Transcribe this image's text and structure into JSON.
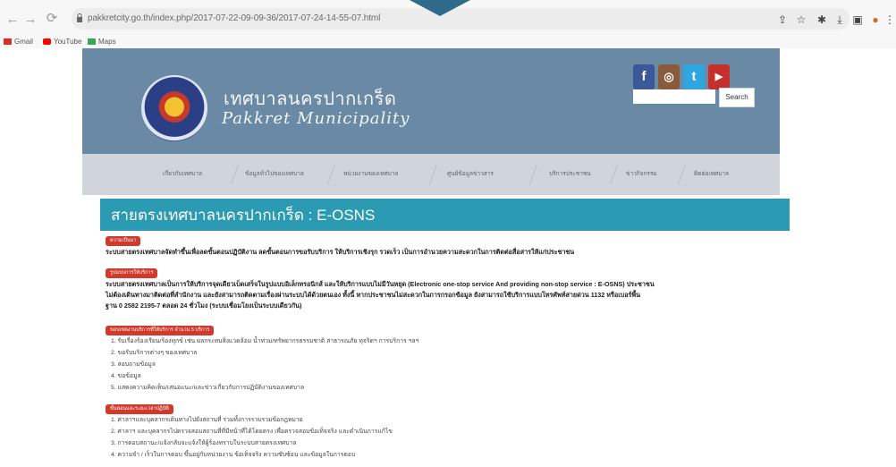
{
  "browser": {
    "url": "pakkretcity.go.th/index.php/2017-07-22-09-09-36/2017-07-24-14-55-07.html",
    "bookmarks": [
      "Gmail",
      "YouTube",
      "Maps"
    ],
    "accent": "#2f6a8a"
  },
  "site": {
    "name_th": "เทศบาลนครปากเกร็ด",
    "name_en": "Pakkret Municipality",
    "search_button": "Search",
    "search_placeholder": "",
    "social": [
      {
        "icon": "facebook-icon",
        "glyph": "f",
        "color": "#3b5998"
      },
      {
        "icon": "instagram-icon",
        "glyph": "◎",
        "color": "#8a5a3c"
      },
      {
        "icon": "twitter-icon",
        "glyph": "t",
        "color": "#2fa6e0"
      },
      {
        "icon": "youtube-icon",
        "glyph": "▶",
        "color": "#c4302b"
      }
    ],
    "header_color": "#6a89a4"
  },
  "menu": [
    "เกี่ยวกับเทศบาล",
    "ข้อมูลทั่วไปของเทศบาล",
    "หน่วยงานของเทศบาล",
    "ศูนย์ข้อมูลข่าวสาร",
    "บริการประชาชน",
    "ข่าวกิจกรรม",
    "ติดต่อเทศบาล"
  ],
  "page": {
    "title": "สายตรงเทศบาลนครปากเกร็ด : E-OSNS",
    "banner_color": "#2b9ab3",
    "sections": [
      {
        "tag": "ความเป็นมา",
        "paragraphs": [
          "ระบบสายตรงเทศบาลจัดทำขึ้นเพื่อลดขั้นตอนปฏิบัติงาน ลดขั้นตอนการขอรับบริการ ให้บริการเชิงรุก รวดเร็ว เป็นการอำนวยความสะดวกในการติดต่อสื่อสารให้แก่ประชาชน"
        ]
      },
      {
        "tag": "รูปแบบการให้บริการ",
        "paragraphs": [
          "ระบบสายตรงเทศบาลเป็นการให้บริการจุดเดียวเบ็ดเสร็จในรูปแบบอิเล็กทรอนิกส์ และให้บริการแบบไม่มีวันหยุด (Electronic one-stop service And providing non-stop service : E-OSNS) ประชาชน",
          "ไม่ต้องเดินทางมาติดต่อที่สำนักงาน และยังสามารถติดตามเรื่องผ่านระบบได้ด้วยตนเอง ทั้งนี้ หากประชาชนไม่สะดวกในการกรอกข้อมูล ยังสามารถใช้บริการแบบโทรศัพท์สายด่วน 1132 หรือเบอร์พื้น",
          "ฐาน 0 2582 2195-7 ตลอด 24 ชั่วโมง (ระบบเชื่อมโยงเป็นระบบเดียวกัน)"
        ]
      },
      {
        "tag": "ขอบเขตงานบริการที่ให้บริการ จำนวน 5 บริการ",
        "items": [
          "1. รับเรื่องร้องเรียน/ร้องทุกข์ เช่น ผลกระทบสิ่งแวดล้อม น้ำท่วม/ทรัพยากรธรรมชาติ สาธารณภัย ทุจริตฯ การบริการ ฯลฯ",
          "2. ขอรับบริการต่างๆ ของเทศบาล",
          "3. สอบถามข้อมูล",
          "4. ขอข้อมูล",
          "5. แสดงความคิดเห็น/เสนอแนะ/และข่าวเกี่ยวกับการปฏิบัติงานของเทศบาล"
        ]
      },
      {
        "tag": "ขั้นตอนและระยะเวลาปฏิบัติ",
        "items": [
          "1. ศาลาฯและบุคลากรเดินทางไปยังสถานที่ ร่วมทั้งการรวบรวมข้อกฎหมาย",
          "2. ศาลาฯ และบุคลากรไปตรวจสอบสถานที่ที่มีหน้าที่ได้โดยตรง เพื่อตรวจสอบข้อเท็จจริง และดำเนินการแก้ไข",
          "3. การตอบสถานะ/แจ้งกลับจะแจ้งให้ผู้ร้องทราบในระบบสายตรงเทศบาล",
          "4. ความจำ / เร็วในการตอบ ขึ้นอยู่กับหน่วยงาน ข้อเท็จจริง ความซับซ้อน และข้อมูลในการตอบ"
        ]
      }
    ]
  }
}
